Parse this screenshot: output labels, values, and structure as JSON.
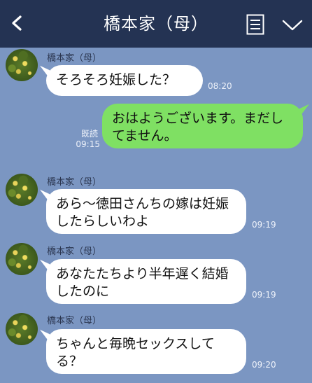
{
  "header": {
    "title": "橋本家（母）",
    "back_icon": "back-chevron-icon",
    "notes_icon": "notes-icon",
    "menu_icon": "chevron-down-icon"
  },
  "colors": {
    "header_bg": "#243353",
    "chat_bg": "#7b96c2",
    "incoming_bubble": "#ffffff",
    "outgoing_bubble": "#7fe063"
  },
  "messages": [
    {
      "sender": "橋本家（母）",
      "text": "そろそろ妊娠した？",
      "time": "08:20"
    },
    {
      "direction": "out",
      "text": "おはようございます。まだしてません。",
      "read": "既読",
      "time": "09:15"
    },
    {
      "sender": "橋本家（母）",
      "text": "あら〜徳田さんちの嫁は妊娠したらしいわよ",
      "time": "09:19"
    },
    {
      "sender": "橋本家（母）",
      "text": "あなたたちより半年遅く結婚したのに",
      "time": "09:19"
    },
    {
      "sender": "橋本家（母）",
      "text": "ちゃんと毎晩セックスしてる？",
      "time": "09:20"
    }
  ]
}
